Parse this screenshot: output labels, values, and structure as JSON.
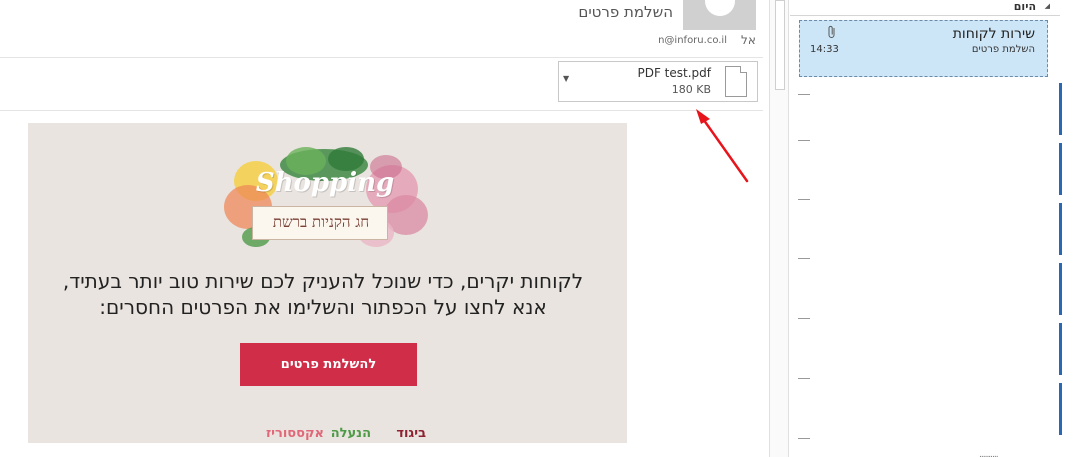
{
  "header": {
    "subject": "השלמת פרטים",
    "to_label": "אל",
    "to_value": "n@inforu.co.il"
  },
  "attachment": {
    "name": "PDF test.pdf",
    "size": "180 KB",
    "dropdown_icon": "caret-down-icon",
    "file_icon": "document-icon"
  },
  "annotation": {
    "arrow_color": "#e8141b"
  },
  "newsletter": {
    "logo_script": "Shopping",
    "logo_banner": "חג הקניות ברשת",
    "headline_line1": "לקוחות יקרים, כדי שנוכל להעניק לכם שירות טוב יותר בעתיד,",
    "headline_line2": "אנא לחצו על הכפתור והשלימו את הפרטים החסרים:",
    "cta_label": "להשלמת פרטים",
    "cta_color": "#cf2d48",
    "background": "#e9e4df",
    "links": [
      {
        "label": "ביגוד",
        "color": "#8c2232"
      },
      {
        "label": "הנעלה",
        "color": "#4d9a47"
      },
      {
        "label": "אקססוריז",
        "color": "#e06878"
      }
    ]
  },
  "message_list": {
    "group_label": "היום",
    "selected_message": {
      "sender": "שירות לקוחות",
      "preview": "השלמת פרטים",
      "time": "14:33",
      "attachment_icon": "paperclip-icon"
    },
    "bottom_marks": "..........",
    "accent": "#2a69b2",
    "selected_bg": "#cde6f7"
  }
}
